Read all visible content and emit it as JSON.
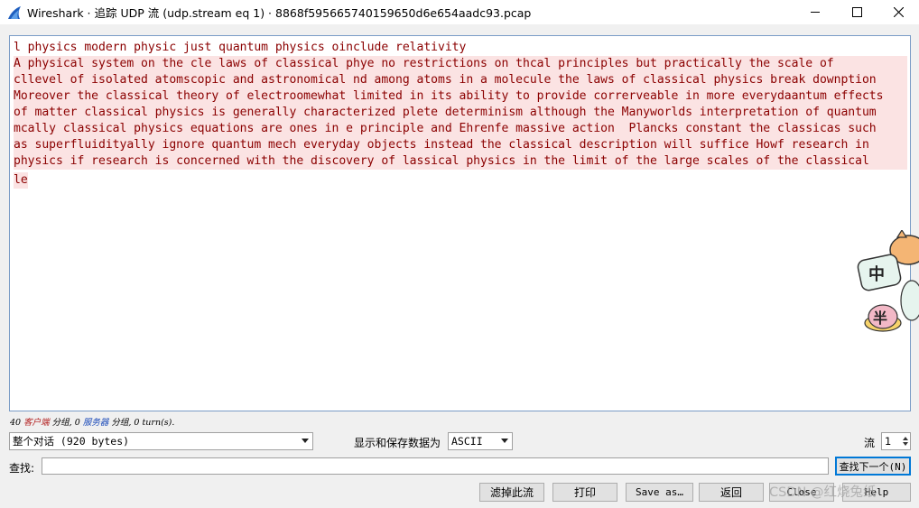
{
  "window": {
    "title": "Wireshark · 追踪 UDP 流 (udp.stream eq 1) · 8868f595665740159650d6e654aadc93.pcap",
    "controls": [
      "minimize-icon",
      "maximize-icon",
      "close-icon"
    ]
  },
  "stream": {
    "lines": [
      "l physics modern physic just quantum physics oinclude relativity",
      "A physical system on the cle laws of classical phye no restrictions on thcal principles but practically the scale of",
      "cllevel of isolated atomscopic and astronomical nd among atoms in a molecule the laws of classical physics break downption",
      "Moreover the classical theory of electroomewhat limited in its ability to provide correrveable in more everydaantum effects",
      "of matter classical physics is generally characterized plete determinism although the Manyworlds interpretation of quantum",
      "mcally classical physics equations are ones in e principle and Ehrenfe massive action  Plancks constant the classicas such",
      "as superfluidityally ignore quantum mech everyday objects instead the classical description will suffice Howf research in",
      "physics if research is concerned with the discovery of lassical physics in the limit of the large scales of the classical",
      "le"
    ]
  },
  "stats": {
    "client_count": "40",
    "client_label": "客户端",
    "client_unit": "分组,",
    "server_count": "0",
    "server_label": "服务器",
    "server_unit": "分组,",
    "turns": "0 turn(s)."
  },
  "conversation_select": {
    "value": "整个对话 (920 bytes)"
  },
  "display_as": {
    "label": "显示和保存数据为",
    "value": "ASCII"
  },
  "stream_number": {
    "label": "流",
    "value": "1"
  },
  "find": {
    "label": "查找:",
    "value": "",
    "next_button": "查找下一个(N)"
  },
  "buttons": {
    "filter_out": "滤掉此流",
    "print": "打印",
    "save_as": "Save as…",
    "back": "返回",
    "close": "Close",
    "help": "Help"
  },
  "watermark": "CSDN @红烧兔纸",
  "sticker": {
    "text_top": "中",
    "text_bottom": "半"
  },
  "colors": {
    "client_text": "#8b0000",
    "client_bg": "#fbe3e3",
    "focus_border": "#0078d7"
  }
}
